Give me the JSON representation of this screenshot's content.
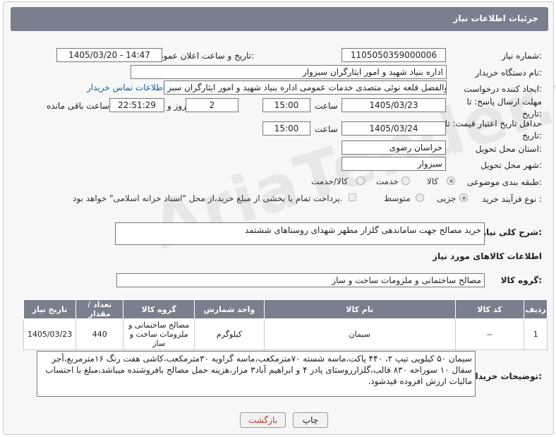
{
  "header": {
    "title": "جزئیات اطلاعات نیاز"
  },
  "fields": {
    "need_no_label": "شماره نیاز:",
    "need_no": "1105050359000006",
    "announce_label": "تاریخ و ساعت اعلان عمومی:",
    "announce": "1405/03/20 - 14:47",
    "buyer_label": "نام دستگاه خریدار:",
    "buyer": "اداره بنیاد شهید و امور ایثارگران سبزوار",
    "creator_label": "ایجاد کننده درخواست:",
    "creator": "ابوالفضل قلعه نوئی متصدی خدمات عمومی اداره بنیاد شهید و امور ایثارگران سبز",
    "contact_link": "اطلاعات تماس خریدار",
    "deadline_label": "مهلت ارسال پاسخ: تا تاریخ:",
    "deadline_date": "1405/03/23",
    "time_word": "ساعت",
    "deadline_time": "15:00",
    "days_value": "2",
    "days_word": "روز و",
    "remaining_time": "22:51:29",
    "remaining_word": "ساعت باقی مانده",
    "validity_label": "حداقل تاریخ اعتبار قیمت: تا تاریخ:",
    "validity_date": "1405/03/24",
    "validity_time": "15:00",
    "province_label": "استان محل تحویل:",
    "province": "خراسان رضوی",
    "city_label": "شهر محل تحویل:",
    "city": "سبزوار",
    "category_label": "طبقه بندی موضوعی:",
    "cat_goods": "کالا",
    "cat_service": "خدمت",
    "cat_both": "کالا/خدمت",
    "process_label": "نوع فرآیند خرید :",
    "proc_partial": "جزیی",
    "proc_medium": "متوسط",
    "payment_note": "پرداخت تمام یا بخشی از مبلغ خرید،از محل \"اسناد خزانه اسلامی\" خواهد بود.",
    "desc_label": "شرح کلی نیاز:",
    "desc": "خرید مصالح جهت ساماندهی گلزار مطهر شهدای روستاهای ششتمد",
    "goods_info": "اطلاعات کالاهای مورد نیاز",
    "group_label": "گروه کالا:",
    "group": "مصالح ساختمانی و ملزومات ساخت و ساز",
    "notes_label": "توضیحات خریدار:",
    "notes": "سیمان ۵۰ کیلویی تیپ ۲، ۴۴۰ پاکت،ماسه شسته ۷۰مترمکعب،ماسه گراویه ۳۰مترمکعب،کاشی هفت رنگ ۱۶مترمربع،آجر سفال ۱۰ سوراخه  ۸۳۰ قالب،گلزارروستای پادر ۴ و ابراهیم آباد۳ مزار،هزینه حمل مصالح بافروشنده میباشد،مبلغ با احتساب مالیات ارزش افزوده قیدشود."
  },
  "table": {
    "headers": [
      "ردیف",
      "کد کالا",
      "نام کالا",
      "واحد شمارش",
      "گروه کالا",
      "تعداد / مقدار",
      "تاریخ نیاز"
    ],
    "rows": [
      [
        "1",
        "--",
        "سیمان",
        "کیلوگرم",
        "مصالح ساختمانی و ملزومات ساخت و ساز",
        "440",
        "1405/03/23"
      ]
    ]
  },
  "buttons": {
    "print": "چاپ",
    "back": "بازگشت"
  },
  "watermark": "AriaTender.neT"
}
